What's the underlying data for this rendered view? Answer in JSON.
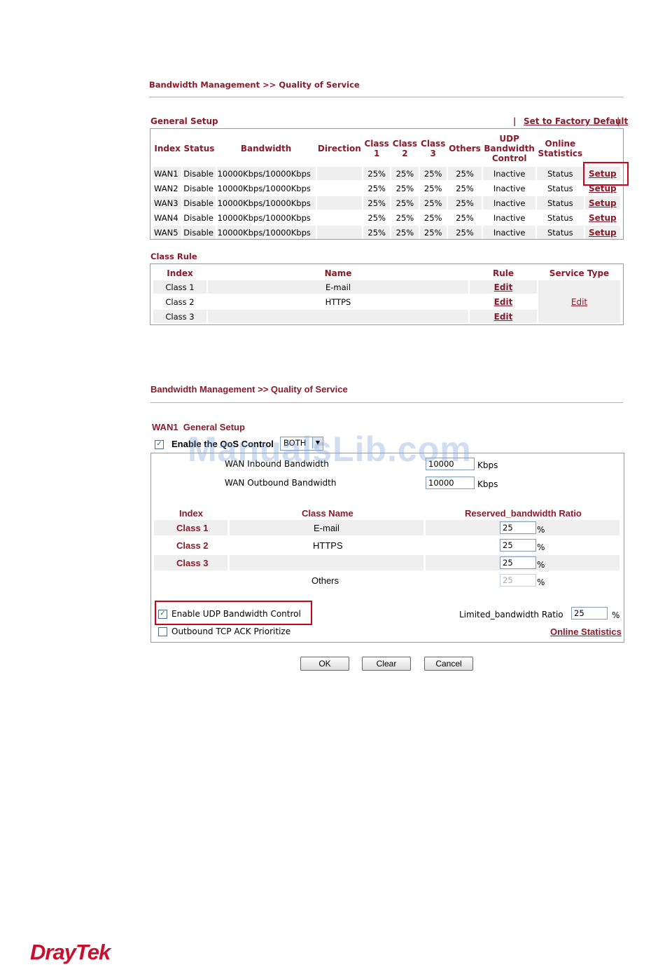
{
  "top": {
    "breadcrumb": "Bandwidth Management >> Quality of Service",
    "general_setup_title": "General Setup",
    "factory_default_link": "Set to Factory Default",
    "pipe_left": "|",
    "pipe_right": "|",
    "wan_table": {
      "headers": {
        "index": "Index",
        "status": "Status",
        "bandwidth": "Bandwidth",
        "direction": "Direction",
        "class1": "Class 1",
        "class2": "Class 2",
        "class3": "Class 3",
        "others": "Others",
        "udp": "UDP Bandwidth Control",
        "online": "Online Statistics"
      },
      "rows": [
        {
          "index": "WAN1",
          "status": "Disable",
          "bandwidth": "10000Kbps/10000Kbps",
          "direction": "",
          "c1": "25%",
          "c2": "25%",
          "c3": "25%",
          "others": "25%",
          "udp": "Inactive",
          "online": "Status",
          "action": "Setup"
        },
        {
          "index": "WAN2",
          "status": "Disable",
          "bandwidth": "10000Kbps/10000Kbps",
          "direction": "",
          "c1": "25%",
          "c2": "25%",
          "c3": "25%",
          "others": "25%",
          "udp": "Inactive",
          "online": "Status",
          "action": "Setup"
        },
        {
          "index": "WAN3",
          "status": "Disable",
          "bandwidth": "10000Kbps/10000Kbps",
          "direction": "",
          "c1": "25%",
          "c2": "25%",
          "c3": "25%",
          "others": "25%",
          "udp": "Inactive",
          "online": "Status",
          "action": "Setup"
        },
        {
          "index": "WAN4",
          "status": "Disable",
          "bandwidth": "10000Kbps/10000Kbps",
          "direction": "",
          "c1": "25%",
          "c2": "25%",
          "c3": "25%",
          "others": "25%",
          "udp": "Inactive",
          "online": "Status",
          "action": "Setup"
        },
        {
          "index": "WAN5",
          "status": "Disable",
          "bandwidth": "10000Kbps/10000Kbps",
          "direction": "",
          "c1": "25%",
          "c2": "25%",
          "c3": "25%",
          "others": "25%",
          "udp": "Inactive",
          "online": "Status",
          "action": "Setup"
        }
      ]
    },
    "class_rule_title": "Class Rule",
    "class_table": {
      "headers": {
        "index": "Index",
        "name": "Name",
        "rule": "Rule",
        "service": "Service Type"
      },
      "rows": [
        {
          "index": "Class 1",
          "name": "E-mail",
          "rule": "Edit"
        },
        {
          "index": "Class 2",
          "name": "HTTPS",
          "rule": "Edit"
        },
        {
          "index": "Class 3",
          "name": "",
          "rule": "Edit"
        }
      ],
      "service_edit": "Edit"
    }
  },
  "bottom": {
    "breadcrumb": "Bandwidth Management >> Quality of Service",
    "title": "WAN1  General Setup",
    "enable_qos_label": "Enable the QoS Control",
    "direction_value": "BOTH",
    "inbound_label": "WAN Inbound Bandwidth",
    "inbound_value": "10000",
    "outbound_label": "WAN Outbound Bandwidth",
    "outbound_value": "10000",
    "unit": "Kbps",
    "headers": {
      "index": "Index",
      "class_name": "Class Name",
      "ratio": "Reserved_bandwidth Ratio"
    },
    "rows": [
      {
        "index": "Class 1",
        "name": "E-mail",
        "ratio": "25"
      },
      {
        "index": "Class 2",
        "name": "HTTPS",
        "ratio": "25"
      },
      {
        "index": "Class 3",
        "name": "",
        "ratio": "25"
      }
    ],
    "others_label": "Others",
    "others_ratio": "25",
    "percent": "%",
    "udp_label": "Enable UDP Bandwidth Control",
    "limited_label": "Limited_bandwidth Ratio",
    "limited_value": "25",
    "tcp_ack_label": "Outbound TCP ACK Prioritize",
    "online_stats_link": "Online Statistics",
    "buttons": {
      "ok": "OK",
      "clear": "Clear",
      "cancel": "Cancel"
    }
  },
  "watermark": "ManualsLib.com",
  "logo": "DrayTek",
  "colors": {
    "accent": "#8b1a2b",
    "highlight": "#d0021b",
    "row_gray": "#efefef"
  }
}
